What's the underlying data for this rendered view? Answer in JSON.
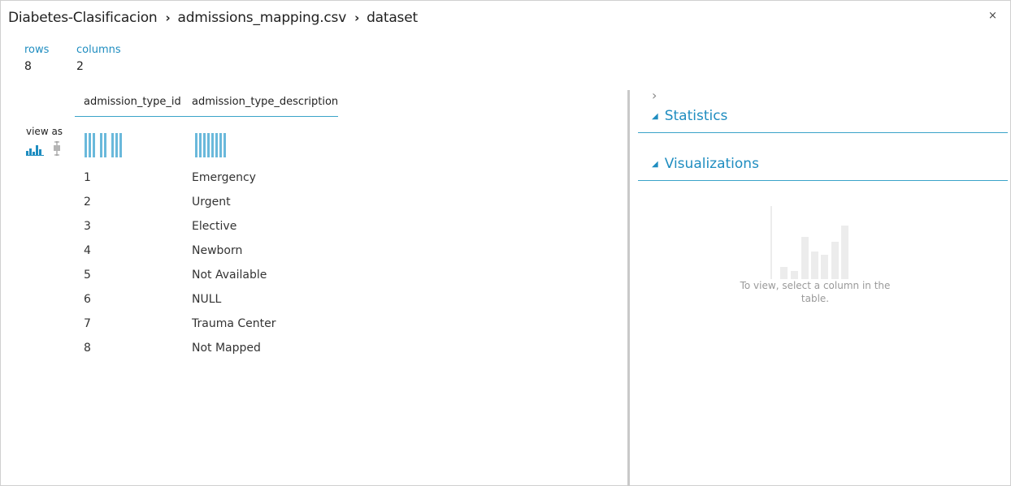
{
  "breadcrumb": {
    "items": [
      "Diabetes-Clasificacion",
      "admissions_mapping.csv",
      "dataset"
    ],
    "separator": "›"
  },
  "close_label": "×",
  "summary": {
    "rows_label": "rows",
    "rows_value": "8",
    "columns_label": "columns",
    "columns_value": "2"
  },
  "view_as": {
    "label": "view as",
    "options": [
      "histogram-icon",
      "boxplot-icon"
    ]
  },
  "table": {
    "columns": [
      "admission_type_id",
      "admission_type_description"
    ],
    "rows": [
      [
        "1",
        "Emergency"
      ],
      [
        "2",
        "Urgent"
      ],
      [
        "3",
        "Elective"
      ],
      [
        "4",
        "Newborn"
      ],
      [
        "5",
        "Not Available"
      ],
      [
        "6",
        "NULL"
      ],
      [
        "7",
        "Trauma Center"
      ],
      [
        "8",
        "Not Mapped"
      ]
    ]
  },
  "right_panel": {
    "expander": "›",
    "statistics_label": "Statistics",
    "visualizations_label": "Visualizations",
    "empty_message": "To view, select a column in the table."
  },
  "colors": {
    "accent": "#1f8dc0",
    "rule": "#3aa3c9",
    "mini_bar": "#6ab9db",
    "placeholder_bar": "#ececec"
  }
}
